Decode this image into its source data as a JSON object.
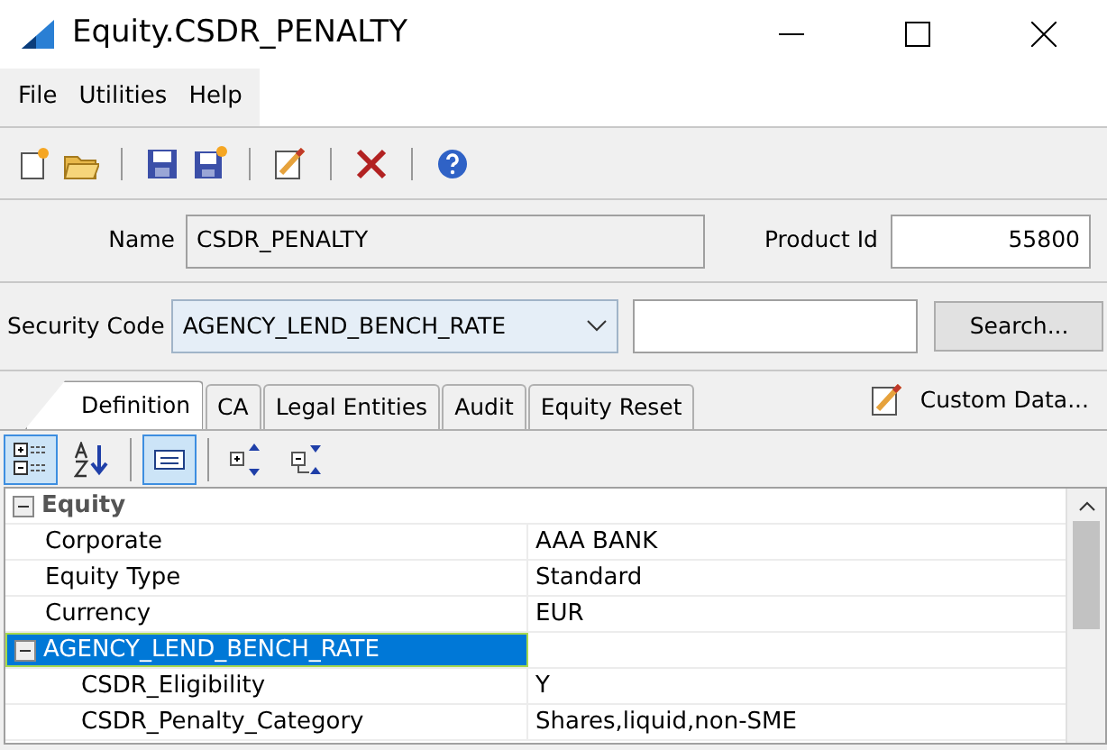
{
  "window": {
    "title": "Equity.CSDR_PENALTY"
  },
  "menu": [
    "File",
    "Utilities",
    "Help"
  ],
  "toolbar": [
    {
      "kind": "new"
    },
    {
      "kind": "open"
    },
    {
      "kind": "sep"
    },
    {
      "kind": "save"
    },
    {
      "kind": "save-new"
    },
    {
      "kind": "sep"
    },
    {
      "kind": "edit"
    },
    {
      "kind": "sep"
    },
    {
      "kind": "delete"
    },
    {
      "kind": "sep"
    },
    {
      "kind": "help"
    }
  ],
  "name_field": {
    "label": "Name",
    "value": "CSDR_PENALTY"
  },
  "product_id": {
    "label": "Product Id",
    "value": "55800"
  },
  "security_code": {
    "label": "Security Code",
    "value": "AGENCY_LEND_BENCH_RATE",
    "search_button": "Search..."
  },
  "tabs": [
    {
      "label": "Definition",
      "selected": true
    },
    {
      "label": "CA",
      "selected": false
    },
    {
      "label": "Legal Entities",
      "selected": false
    },
    {
      "label": "Audit",
      "selected": false
    },
    {
      "label": "Equity Reset",
      "selected": false
    }
  ],
  "custom_data": "Custom Data...",
  "grid_toolbar": [
    {
      "kind": "categorized",
      "selected": true
    },
    {
      "kind": "alphabetical",
      "selected": false
    },
    {
      "kind": "sep"
    },
    {
      "kind": "pages",
      "selected": true
    },
    {
      "kind": "sep"
    },
    {
      "kind": "expand"
    },
    {
      "kind": "collapse"
    }
  ],
  "grid": [
    {
      "label": "Equity",
      "expanded": true,
      "selected": false,
      "children": [
        {
          "label": "Corporate",
          "value": "AAA BANK"
        },
        {
          "label": "Equity Type",
          "value": "Standard"
        },
        {
          "label": "Currency",
          "value": "EUR"
        }
      ]
    },
    {
      "label": "AGENCY_LEND_BENCH_RATE",
      "expanded": true,
      "selected": true,
      "children": [
        {
          "label": "CSDR_Eligibility",
          "value": "Y"
        },
        {
          "label": "CSDR_Penalty_Category",
          "value": "Shares,liquid,non-SME"
        }
      ]
    }
  ]
}
